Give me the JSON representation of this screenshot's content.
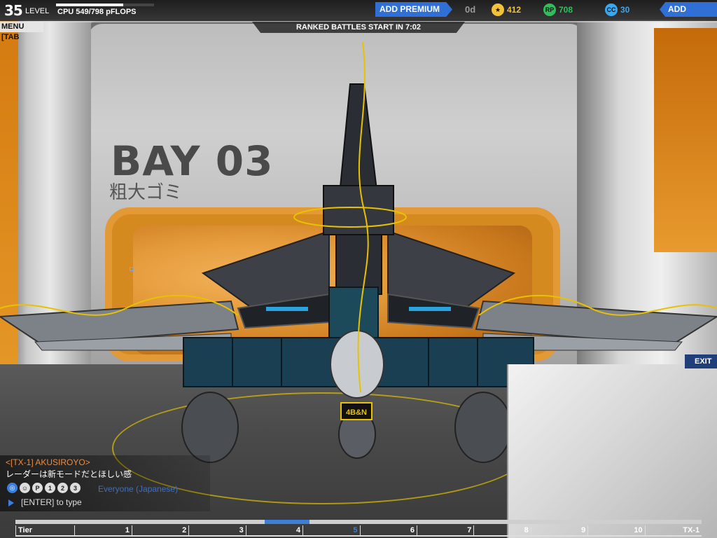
{
  "hud": {
    "level": "35",
    "level_label": "LEVEL",
    "cpu": "CPU 549/798 pFLOPS",
    "cpu_fraction": 0.688,
    "add_premium": "ADD PREMIUM",
    "premium_days": "0d",
    "currencies": [
      {
        "icon": "star-icon",
        "value": "412",
        "color": "#f2c23a"
      },
      {
        "icon": "robits-icon",
        "value": "708",
        "color": "#2fbf5a"
      },
      {
        "icon": "cosmetic-credits-icon",
        "value": "30",
        "color": "#3aa8f0"
      }
    ],
    "add_funds": "ADD FUNDS",
    "menu_tab": "MENU [TAB",
    "ranked": "RANKED BATTLES START IN 7:02"
  },
  "bay": {
    "title": "BAY 03",
    "subtitle": "粗大ゴミ"
  },
  "robot": {
    "badge": "4B&N"
  },
  "chat": {
    "sender": "<[TX-1] AKUSIROYO>",
    "message": "レーダーは新モードだとほしい感",
    "channel": "Everyone (Japanese)",
    "input_hint": "[ENTER] to type",
    "channel_icons": [
      "globe-icon",
      "person-icon",
      "party-icon",
      "friends-icon",
      "clan-icon",
      "group-icon"
    ]
  },
  "exit": "EXIT",
  "tiers": {
    "labels": [
      "Tier",
      "1",
      "2",
      "3",
      "4",
      "5",
      "6",
      "7",
      "8",
      "9",
      "10",
      "TX-1"
    ],
    "current_index": 5
  }
}
